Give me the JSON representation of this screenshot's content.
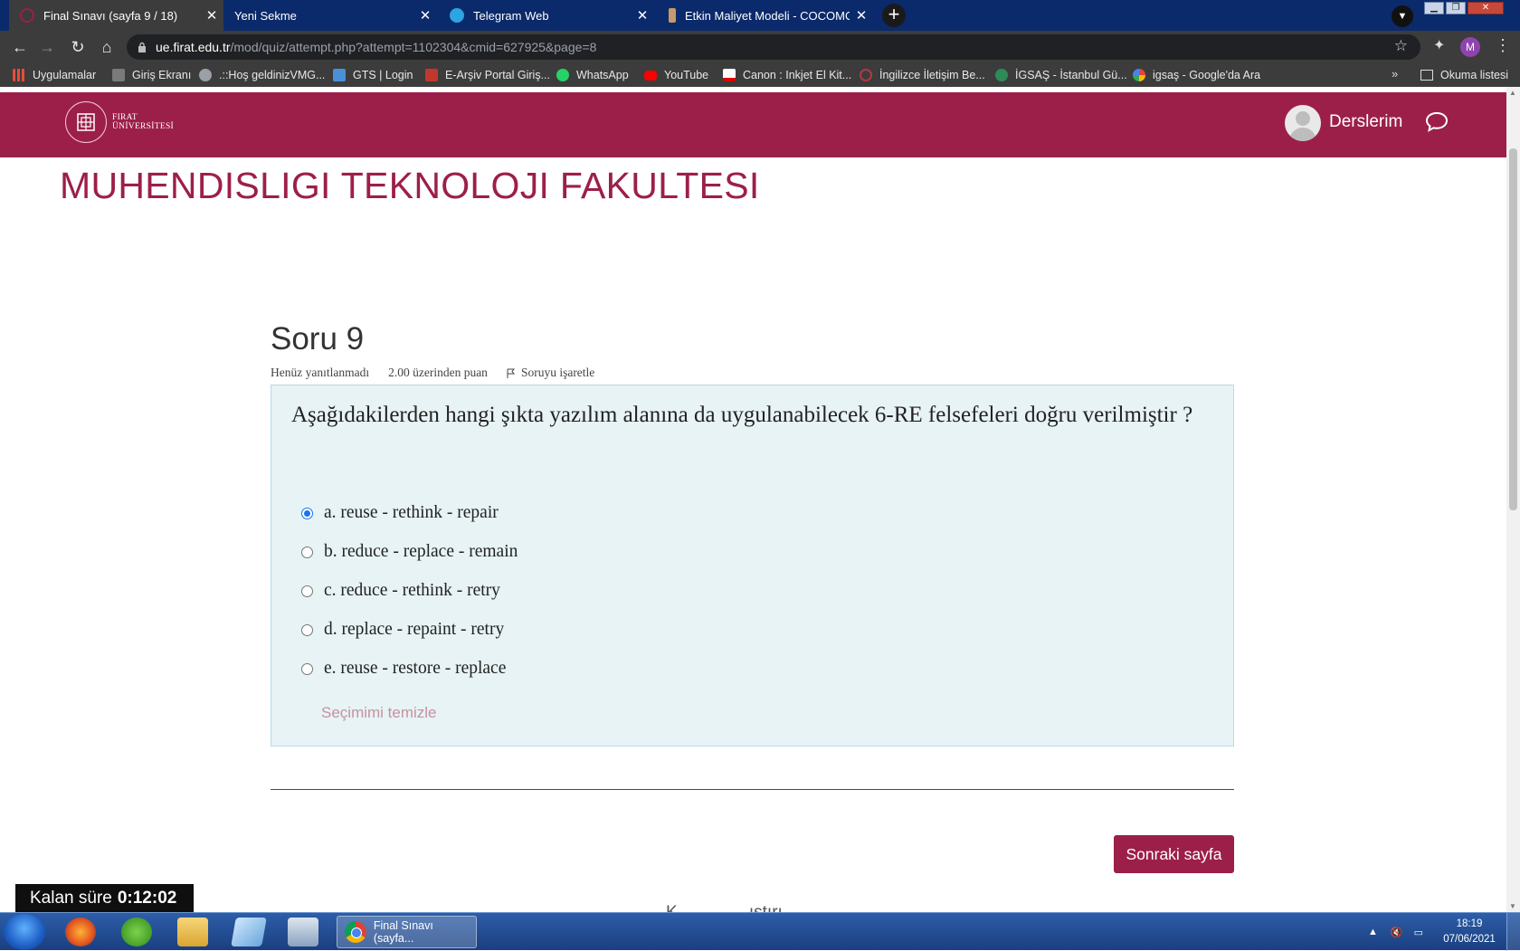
{
  "browser": {
    "tabs": [
      {
        "title": "Final Sınavı (sayfa 9 / 18)",
        "active": true,
        "favicon_color": "#9c1f4a"
      },
      {
        "title": "Yeni Sekme",
        "active": false,
        "favicon_color": ""
      },
      {
        "title": "Telegram Web",
        "active": false,
        "favicon_color": "#2ca5e0"
      },
      {
        "title": "Etkin Maliyet Modeli - COCOMO",
        "active": false,
        "favicon_color": "#c79a6b"
      }
    ],
    "url_host": "ue.firat.edu.tr",
    "url_path": "/mod/quiz/attempt.php?attempt=1102304&cmid=627925&page=8",
    "profile_initial": "M",
    "bookmarks": [
      {
        "label": "Uygulamalar",
        "icon_color": "#e84c3d"
      },
      {
        "label": "Giriş Ekranı",
        "icon_color": "#7a7a7a"
      },
      {
        "label": ".::Hoş geldinizVMG...",
        "icon_color": "#9aa0a6"
      },
      {
        "label": "GTS | Login",
        "icon_color": "#4a90d9"
      },
      {
        "label": "E-Arşiv Portal Giriş...",
        "icon_color": "#c0392b"
      },
      {
        "label": "WhatsApp",
        "icon_color": "#25d366"
      },
      {
        "label": "YouTube",
        "icon_color": "#ff0000"
      },
      {
        "label": "Canon : Inkjet El Kit...",
        "icon_color": "#e00000"
      },
      {
        "label": "İngilizce İletişim Be...",
        "icon_color": "#b03a48"
      },
      {
        "label": "İGSAŞ - İstanbul Gü...",
        "icon_color": "#2e8b57"
      },
      {
        "label": "igsaş - Google'da Ara",
        "icon_color": "#4285f4"
      }
    ],
    "bookmarks_more": "»",
    "reading_list": "Okuma listesi"
  },
  "site": {
    "logo_line1": "FIRAT",
    "logo_line2": "ÜNİVERSİTESİ",
    "user_menu_label": "Derslerim",
    "brand_color": "#9c1f4a"
  },
  "page": {
    "faculty_heading": "MUHENDISLIGI TEKNOLOJI FAKULTESI",
    "question_number": "Soru 9",
    "status": "Henüz yanıtlanmadı",
    "grade": "2.00 üzerinden puan",
    "flag_label": "Soruyu işaretle",
    "question_text": "Aşağıdakilerden hangi şıkta yazılım alanına da uygulanabilecek 6-RE felsefeleri doğru verilmiştir ?",
    "options": [
      {
        "label": "a. reuse - rethink - repair",
        "checked": true
      },
      {
        "label": "b. reduce - replace - remain",
        "checked": false
      },
      {
        "label": "c. reduce - rethink - retry",
        "checked": false
      },
      {
        "label": "d. replace - repaint - retry",
        "checked": false
      },
      {
        "label": "e. reuse - restore - replace",
        "checked": false
      }
    ],
    "clear_choice": "Seçimimi temizle",
    "next_button": "Sonraki sayfa",
    "peek_text": "K...............ıştırı...",
    "timer_label": "Kalan süre",
    "timer_value": "0:12:02"
  },
  "taskbar": {
    "active_task": "Final Sınavı (sayfa...",
    "time": "18:19",
    "date": "07/06/2021"
  }
}
